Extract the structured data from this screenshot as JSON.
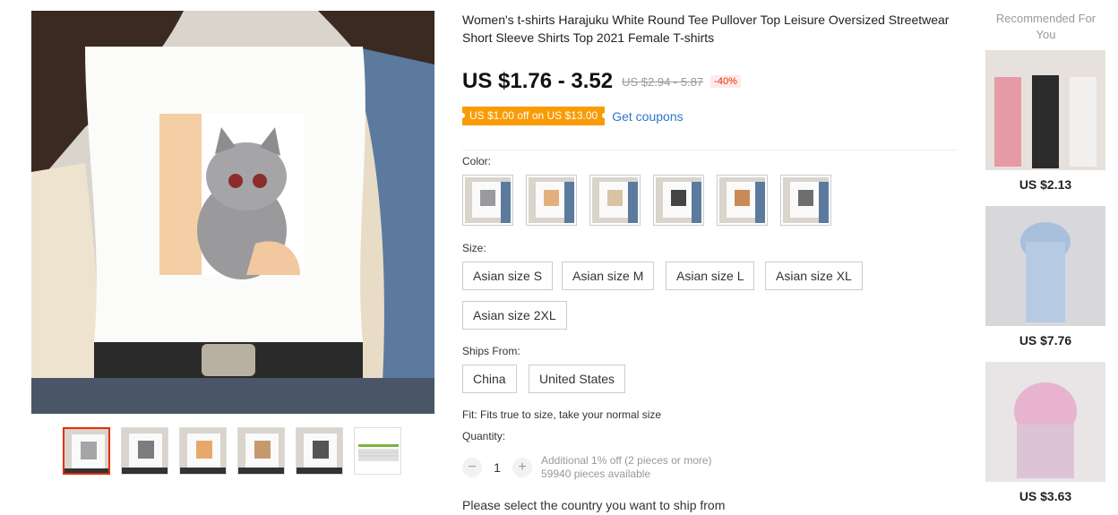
{
  "product": {
    "title": "Women's t-shirts Harajuku White Round Tee Pullover Top Leisure Oversized Streetwear Short Sleeve Shirts Top 2021 Female T-shirts",
    "price": "US $1.76 - 3.52",
    "old_price": "US $2.94 - 5.87",
    "discount": "-40%",
    "coupon_badge": "US $1.00 off on US $13.00",
    "coupon_link": "Get coupons"
  },
  "color": {
    "label": "Color:",
    "options_count": 6,
    "selected_index": -1
  },
  "size": {
    "label": "Size:",
    "options": [
      "Asian size S",
      "Asian size M",
      "Asian size L",
      "Asian size XL",
      "Asian size 2XL"
    ]
  },
  "ships_from": {
    "label": "Ships From:",
    "options": [
      "China",
      "United States"
    ]
  },
  "fit": "Fit: Fits true to size, take your normal size",
  "quantity": {
    "label": "Quantity:",
    "value": "1",
    "minus": "−",
    "plus": "+",
    "discount_note": "Additional 1% off (2 pieces or more)",
    "available": "59940 pieces available"
  },
  "ship_note": "Please select the country you want to ship from",
  "recommended": {
    "title": "Recommended For You",
    "items": [
      {
        "price": "US $2.13"
      },
      {
        "price": "US $7.76"
      },
      {
        "price": "US $3.63"
      }
    ]
  },
  "gallery": {
    "thumbnail_count": 6,
    "active_index": 0
  },
  "colors": {
    "accent": "#e62e04",
    "coupon": "#f99b05",
    "link": "#2e76c8"
  }
}
